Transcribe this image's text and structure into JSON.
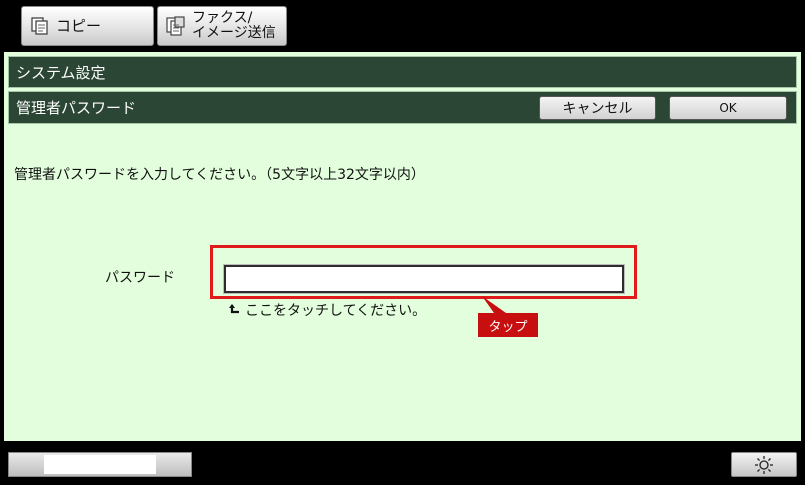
{
  "tabs": {
    "copy": {
      "label": "コピー",
      "icon": "copy-icon"
    },
    "fax": {
      "label": "ファクス/\nイメージ送信",
      "icon": "fax-scan-icon"
    }
  },
  "header": {
    "system_settings": "システム設定",
    "admin_password": "管理者パスワード",
    "cancel_label": "キャンセル",
    "ok_label": "OK"
  },
  "main": {
    "instruction": "管理者パスワードを入力してください。（5文字以上32文字以内）",
    "password_label": "パスワード",
    "password_value": "",
    "hint": "ここをタッチしてください。",
    "tap_label": "タップ"
  },
  "colors": {
    "panel_bg": "#e3fedd",
    "bar_bg": "#2b4634",
    "highlight": "#e01b1b",
    "tap_tag": "#c70f0f"
  },
  "icons": {
    "hint_arrow": "return-arrow-icon",
    "brightness": "brightness-icon"
  }
}
